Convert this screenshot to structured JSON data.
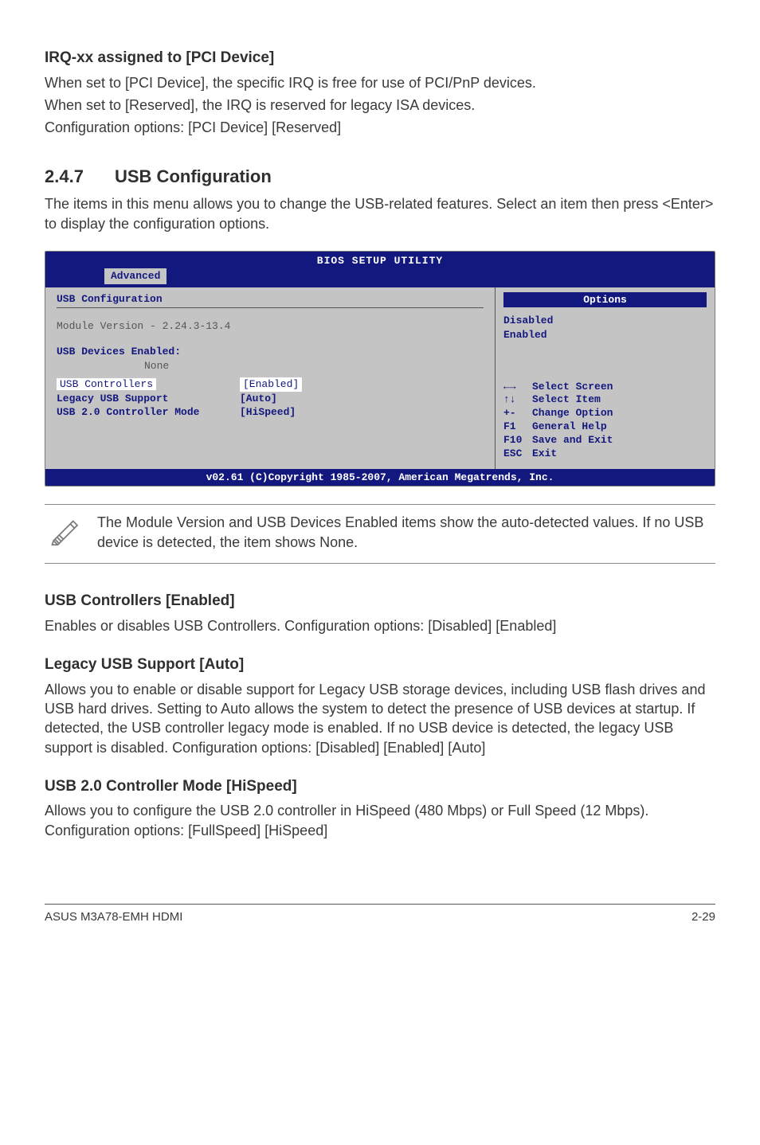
{
  "section_irq": {
    "heading": "IRQ-xx assigned to [PCI Device]",
    "line1": "When set to [PCI Device], the specific IRQ is free for use of PCI/PnP devices.",
    "line2": "When set to [Reserved], the IRQ is reserved for legacy ISA devices.",
    "line3": "Configuration options: [PCI Device] [Reserved]"
  },
  "section_usbcfg": {
    "number": "2.4.7",
    "title": "USB Configuration",
    "intro": "The items in this menu allows you to change the USB-related features. Select an item then press <Enter> to display the configuration options."
  },
  "bios": {
    "title": "BIOS SETUP UTILITY",
    "tab": "Advanced",
    "left_header": "USB Configuration",
    "module_line": "Module Version - 2.24.3-13.4",
    "devices_hdr": "USB Devices Enabled:",
    "devices_val": "None",
    "rows": [
      {
        "label": "USB Controllers",
        "value": "[Enabled]"
      },
      {
        "label": "Legacy USB Support",
        "value": "[Auto]"
      },
      {
        "label": "USB 2.0 Controller Mode",
        "value": "[HiSpeed]"
      }
    ],
    "options_title": "Options",
    "options": [
      "Disabled",
      "Enabled"
    ],
    "help": [
      {
        "key": "←→",
        "text": "Select Screen"
      },
      {
        "key": "↑↓",
        "text": "Select Item"
      },
      {
        "key": "+-",
        "text": "Change Option"
      },
      {
        "key": "F1",
        "text": "General Help"
      },
      {
        "key": "F10",
        "text": "Save and Exit"
      },
      {
        "key": "ESC",
        "text": "Exit"
      }
    ],
    "footer": "v02.61 (C)Copyright 1985-2007, American Megatrends, Inc."
  },
  "note": {
    "text": "The Module Version and USB Devices Enabled items show the auto-detected values. If no USB device is detected, the item shows None."
  },
  "section_ctrl": {
    "heading": "USB Controllers [Enabled]",
    "body": "Enables or disables USB Controllers. Configuration options: [Disabled] [Enabled]"
  },
  "section_legacy": {
    "heading": "Legacy USB Support [Auto]",
    "body": "Allows you to enable or disable support for Legacy USB storage devices, including USB flash drives and USB hard drives. Setting to Auto allows the system to detect the presence of USB devices at startup. If detected, the USB controller legacy mode is enabled. If no USB device is detected, the legacy USB support is disabled. Configuration options: [Disabled] [Enabled] [Auto]"
  },
  "section_mode": {
    "heading": "USB 2.0 Controller Mode [HiSpeed]",
    "body": "Allows you to configure the USB 2.0 controller in HiSpeed (480 Mbps) or Full Speed (12 Mbps). Configuration options: [FullSpeed] [HiSpeed]"
  },
  "footer": {
    "left": "ASUS M3A78-EMH HDMI",
    "right": "2-29"
  }
}
